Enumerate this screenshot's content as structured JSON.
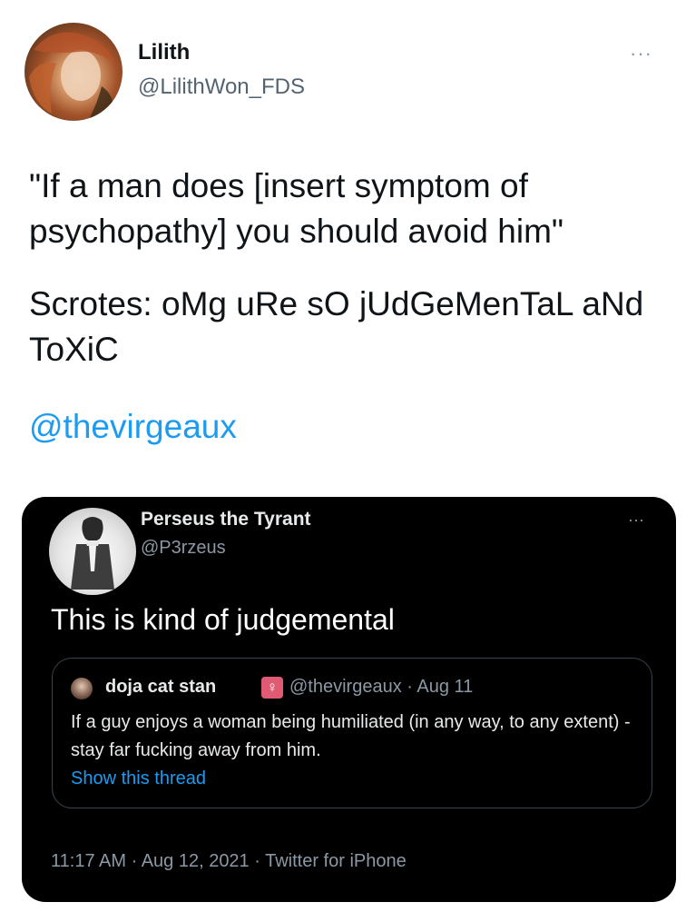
{
  "tweet": {
    "author_name": "Lilith",
    "author_handle": "@LilithWon_FDS",
    "more": "···",
    "text_line1": "\"If a man does [insert symptom of psychopathy] you should avoid him\"",
    "text_line2": "Scrotes: oMg uRe sO jUdGeMenTaL aNd ToXiC",
    "mention": "@thevirgeaux"
  },
  "embedded": {
    "author_name": "Perseus the Tyrant",
    "author_handle": "@P3rzeus",
    "more": "···",
    "text": "This is kind of judgemental",
    "quote": {
      "author_name": "doja cat stan",
      "badge": "♀",
      "meta": "@thevirgeaux · Aug 11",
      "text": "If a guy enjoys a woman being humiliated (in any way, to any extent) - stay far fucking away from him.",
      "show_thread": "Show this thread"
    },
    "footer": "11:17 AM · Aug 12, 2021 · Twitter for iPhone"
  },
  "colors": {
    "link": "#1d9bf0",
    "card_bg": "#000000",
    "badge_pink": "#e05a74"
  }
}
